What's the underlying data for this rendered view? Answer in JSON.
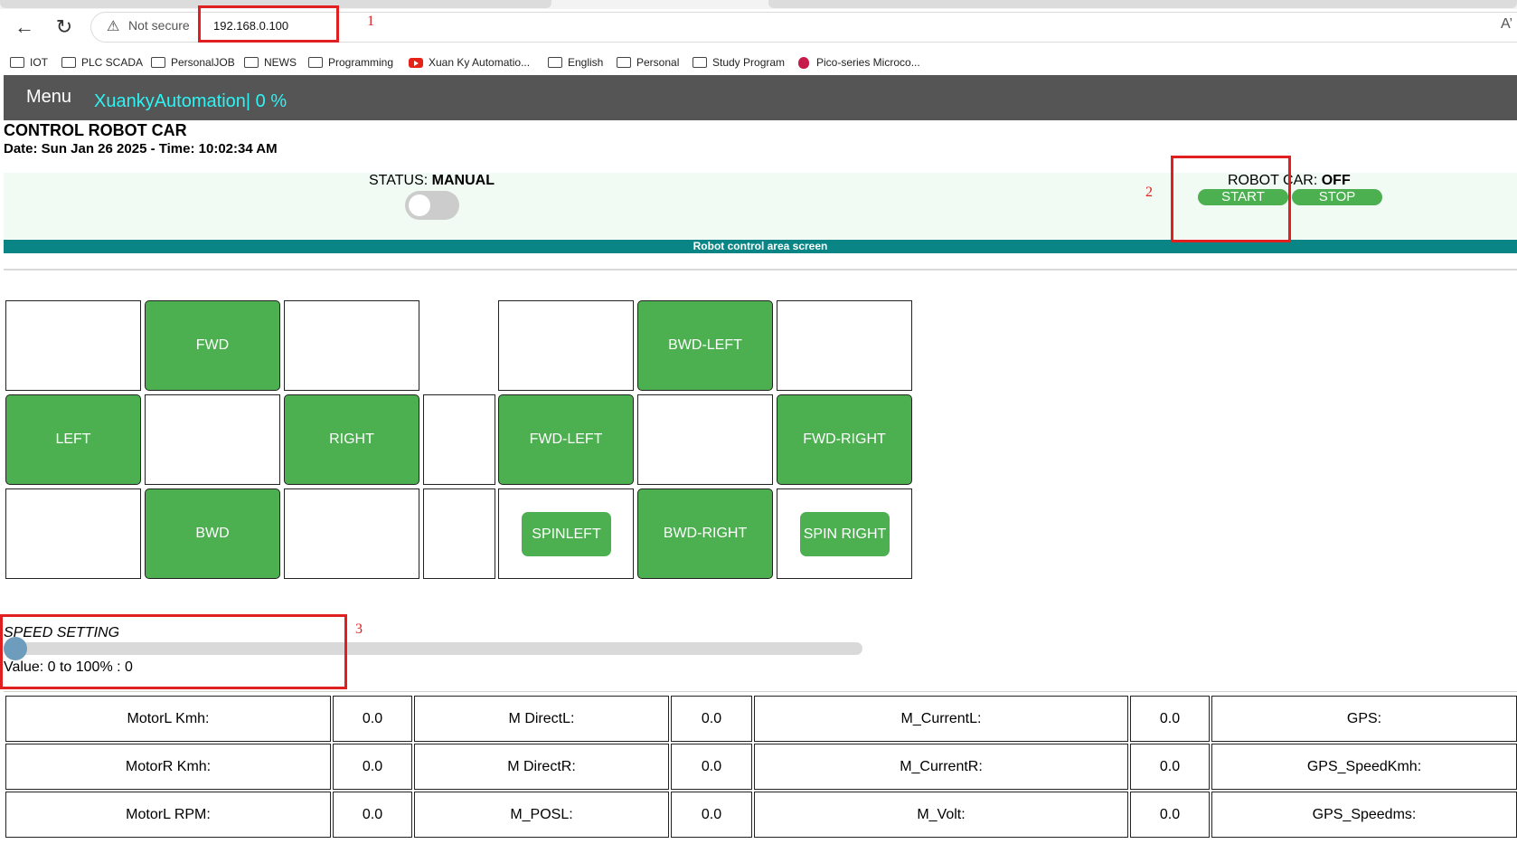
{
  "browser": {
    "security_label": "Not secure",
    "url": "192.168.0.100",
    "bookmarks": [
      "IOT",
      "PLC SCADA",
      "PersonalJOB",
      "NEWS",
      "Programming",
      "Xuan Ky Automatio...",
      "English",
      "Personal",
      "Study Program",
      "Pico-series Microco..."
    ]
  },
  "app": {
    "menu_label": "Menu",
    "brand": "XuankyAutomation| 0 %",
    "title": "CONTROL ROBOT CAR",
    "datetime": "Date: Sun Jan 26 2025 - Time: 10:02:34 AM",
    "status_label": "STATUS: ",
    "status_value": "MANUAL",
    "robot_label": "ROBOT CAR: ",
    "robot_value": "OFF",
    "start_label": "START",
    "stop_label": "STOP",
    "area_title": "Robot control area screen"
  },
  "controls": {
    "fwd": "FWD",
    "left": "LEFT",
    "right": "RIGHT",
    "bwd": "BWD",
    "bwd_left": "BWD-LEFT",
    "fwd_left": "FWD-LEFT",
    "fwd_right": "FWD-RIGHT",
    "spin_left": "SPINLEFT",
    "bwd_right": "BWD-RIGHT",
    "spin_right": "SPIN RIGHT"
  },
  "speed": {
    "title": "SPEED SETTING",
    "value_text": "Value: 0 to 100% : 0",
    "value_percent": 0
  },
  "table": {
    "rows": [
      [
        "MotorL Kmh:",
        "0.0",
        "M DirectL:",
        "0.0",
        "M_CurrentL:",
        "0.0",
        "GPS:"
      ],
      [
        "MotorR Kmh:",
        "0.0",
        "M DirectR:",
        "0.0",
        "M_CurrentR:",
        "0.0",
        "GPS_SpeedKmh:"
      ],
      [
        "MotorL RPM:",
        "0.0",
        "M_POSL:",
        "0.0",
        "M_Volt:",
        "0.0",
        "GPS_Speedms:"
      ]
    ]
  },
  "annotations": {
    "a1": "1",
    "a2": "2",
    "a3": "3"
  },
  "colors": {
    "nav": "#555555",
    "brand": "#2ff3f3",
    "button_green": "#4caf50",
    "area_bar": "#0a8585",
    "annotation_red": "#e02020"
  }
}
